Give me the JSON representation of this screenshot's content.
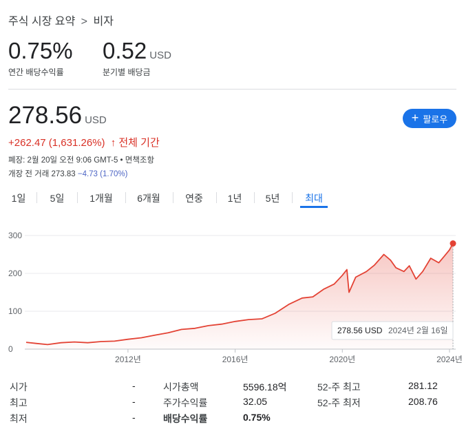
{
  "breadcrumb": {
    "parent": "주식 시장 요약",
    "separator": ">",
    "current": "비자"
  },
  "dividend_yield": {
    "value": "0.75%",
    "label": "연간 배당수익률"
  },
  "dividend": {
    "value": "0.52",
    "unit": "USD",
    "label": "분기별 배당금"
  },
  "price": {
    "value": "278.56",
    "unit": "USD"
  },
  "change": {
    "text": "+262.47 (1,631.26%)",
    "arrow": "↑",
    "period": "전체 기간"
  },
  "meta": {
    "close_line": "폐장: 2월 20일 오전 9:06 GMT-5 • 면책조항",
    "premarket_prefix": "개장 전 거래 273.83 ",
    "premarket_change": "−4.73 (1.70%)"
  },
  "follow_button": {
    "icon": "plus-icon",
    "label": "팔로우"
  },
  "tabs": [
    {
      "label": "1일"
    },
    {
      "label": "5일"
    },
    {
      "label": "1개월"
    },
    {
      "label": "6개월"
    },
    {
      "label": "연중"
    },
    {
      "label": "1년"
    },
    {
      "label": "5년"
    },
    {
      "label": "최대",
      "active": true
    }
  ],
  "tooltip": {
    "price": "278.56 USD",
    "date": "2024년 2월 16일"
  },
  "colors": {
    "line": "#e34234",
    "accent": "#1a73e8",
    "negative": "#d93025",
    "grid": "#e8eaed"
  },
  "chart_data": {
    "type": "area",
    "x_ticks": [
      "2012년",
      "2016년",
      "2020년",
      "2024년"
    ],
    "y_ticks": [
      0,
      100,
      200,
      300
    ],
    "ylim": [
      0,
      300
    ],
    "xlim": [
      2008.2,
      2024.13
    ],
    "grid": true,
    "series": [
      {
        "x": [
          2008.2,
          2008.6,
          2009.0,
          2009.5,
          2010.0,
          2010.5,
          2011.0,
          2011.5,
          2012.0,
          2012.5,
          2013.0,
          2013.5,
          2014.0,
          2014.5,
          2015.0,
          2015.5,
          2016.0,
          2016.5,
          2017.0,
          2017.5,
          2018.0,
          2018.5,
          2018.9,
          2019.3,
          2019.7,
          2020.0,
          2020.17,
          2020.25,
          2020.5,
          2020.9,
          2021.2,
          2021.55,
          2021.8,
          2022.0,
          2022.3,
          2022.5,
          2022.75,
          2023.0,
          2023.3,
          2023.6,
          2023.8,
          2024.0,
          2024.13
        ],
        "y": [
          18,
          15,
          12,
          17,
          19,
          17,
          20,
          21,
          26,
          30,
          37,
          43,
          52,
          55,
          62,
          66,
          73,
          78,
          80,
          95,
          118,
          135,
          138,
          158,
          172,
          195,
          210,
          150,
          190,
          205,
          222,
          250,
          235,
          215,
          205,
          220,
          185,
          205,
          240,
          228,
          245,
          262,
          279
        ]
      }
    ]
  },
  "stats": [
    [
      {
        "label": "시가",
        "value": "-"
      },
      {
        "label": "시가총액",
        "value": "5596.18억"
      },
      {
        "label": "52-주 최고",
        "value": "281.12"
      }
    ],
    [
      {
        "label": "최고",
        "value": "-"
      },
      {
        "label": "주가수익률",
        "value": "32.05"
      },
      {
        "label": "52-주 최저",
        "value": "208.76"
      }
    ],
    [
      {
        "label": "최저",
        "value": "-"
      },
      {
        "label": "배당수익률",
        "value": "0.75%"
      }
    ]
  ]
}
